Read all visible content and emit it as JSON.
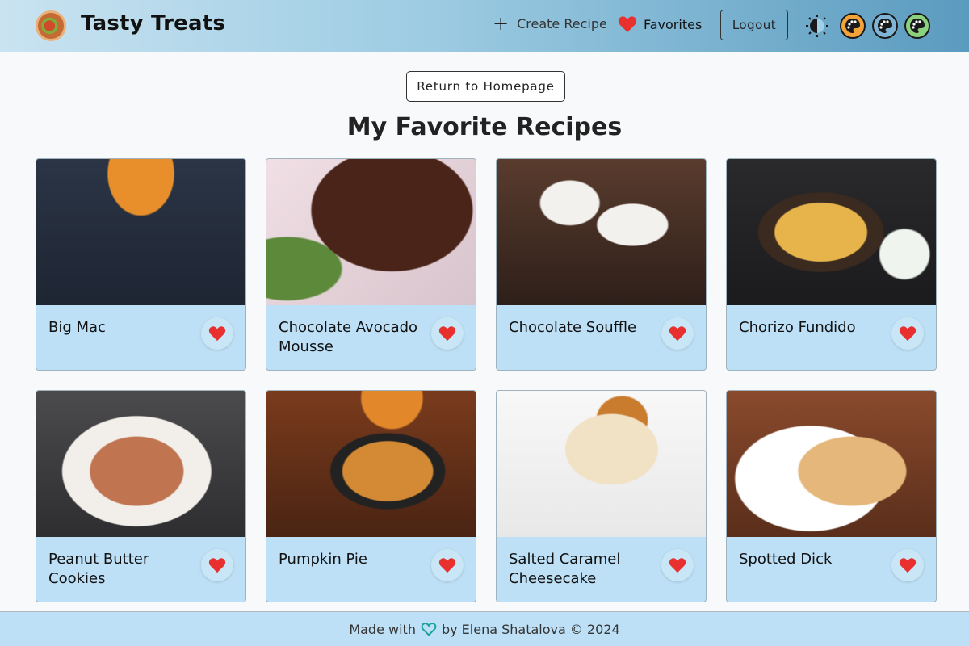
{
  "header": {
    "brand": "Tasty Treats",
    "create_label": "Create Recipe",
    "favorites_label": "Favorites",
    "logout_label": "Logout"
  },
  "main": {
    "return_label": "Return to Homepage",
    "title": "My Favorite Recipes",
    "recipes": [
      {
        "name": "Big Mac"
      },
      {
        "name": "Chocolate Avocado Mousse"
      },
      {
        "name": "Chocolate Souffle"
      },
      {
        "name": "Chorizo Fundido"
      },
      {
        "name": "Peanut Butter Cookies"
      },
      {
        "name": "Pumpkin Pie"
      },
      {
        "name": "Salted Caramel Cheesecake"
      },
      {
        "name": "Spotted Dick"
      }
    ]
  },
  "footer": {
    "prefix": "Made with",
    "suffix": "by Elena Shatalova © 2024"
  },
  "colors": {
    "heart": "#e8312f",
    "card_bg": "#bde0f6",
    "footer_heart": "#1aa39a"
  },
  "icons": [
    "logo-icon",
    "plus-icon",
    "heart-icon",
    "theme-toggle-icon",
    "palette-icon"
  ]
}
